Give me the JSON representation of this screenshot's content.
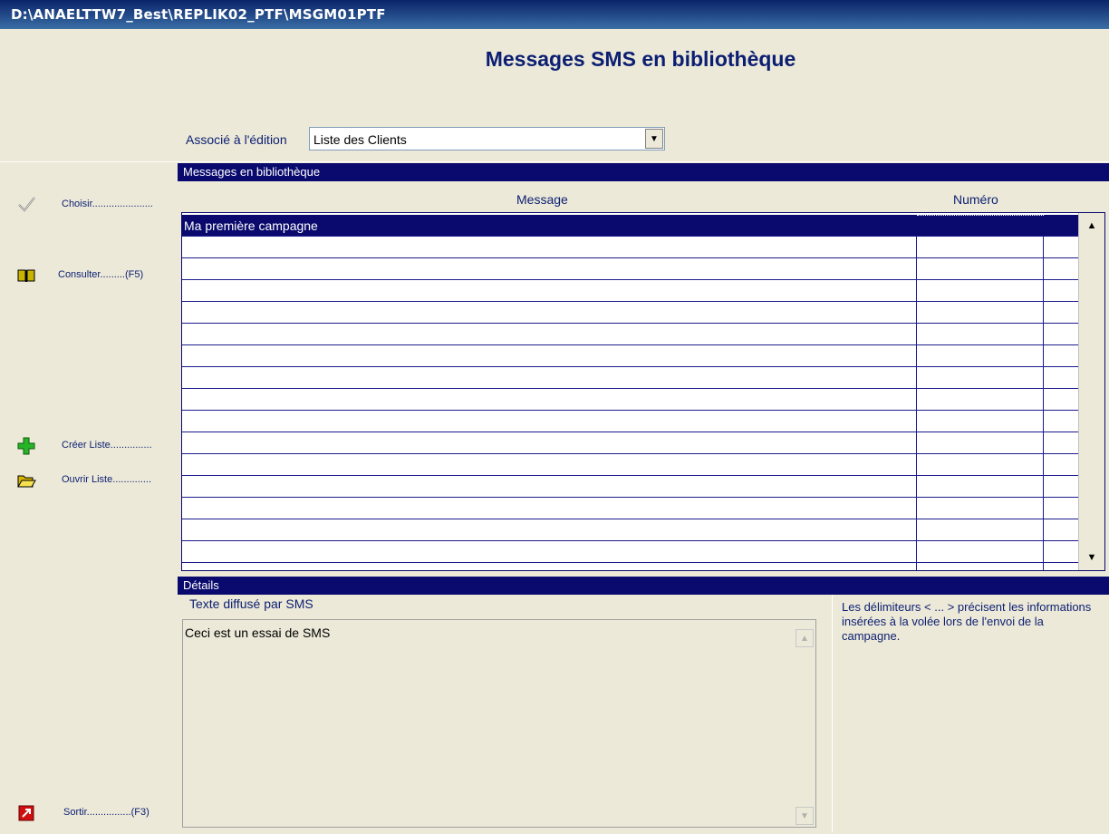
{
  "window": {
    "title": "D:\\ANAELTTW7_Best\\REPLIK02_PTF\\MSGM01PTF"
  },
  "page": {
    "title": "Messages SMS en bibliothèque"
  },
  "edition": {
    "label": "Associé à l'édition",
    "value": "Liste des Clients"
  },
  "sidebar": {
    "items": [
      {
        "icon": "checkmark-icon",
        "label": "Choisir......................"
      },
      {
        "icon": "book-icon",
        "label": "Consulter.........(F5)"
      },
      {
        "icon": "green-plus-icon",
        "label": "Créer Liste..............."
      },
      {
        "icon": "open-folder-icon",
        "label": "Ouvrir Liste.............."
      },
      {
        "icon": "exit-icon",
        "label": "Sortir................(F3)"
      }
    ]
  },
  "library": {
    "section_title": "Messages en bibliothèque",
    "columns": [
      "Message",
      "Numéro"
    ],
    "rows": [
      {
        "message": "Ma première campagne",
        "numero": ""
      }
    ]
  },
  "details": {
    "section_title": "Détails",
    "text_label": "Texte diffusé par SMS",
    "text_value": "Ceci est un essai de SMS",
    "hint": "Les délimiteurs < ... > précisent les informations insérées à la volée lors de l'envoi de la campagne."
  },
  "colors": {
    "navy": "#0a0a6e",
    "label_blue": "#0b1e72",
    "window_bg": "#ece9d8"
  }
}
